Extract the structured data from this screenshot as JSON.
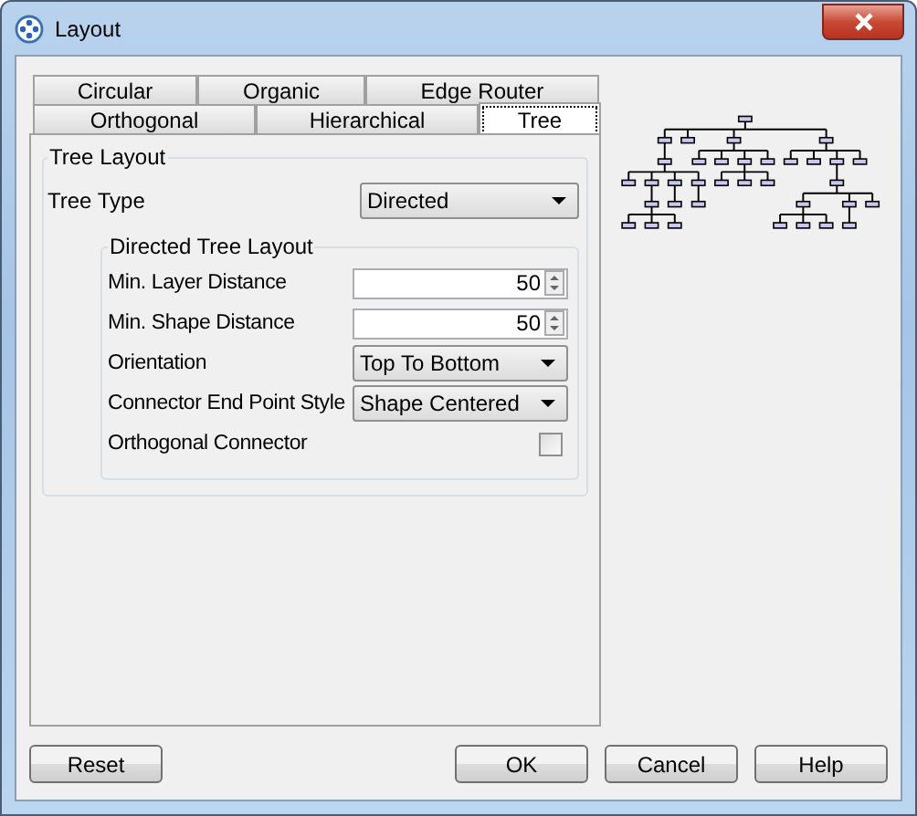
{
  "window": {
    "title": "Layout"
  },
  "tab_rows": [
    [
      {
        "label": "Circular",
        "selected": false
      },
      {
        "label": "Organic",
        "selected": false
      },
      {
        "label": "Edge Router",
        "selected": false
      }
    ],
    [
      {
        "label": "Orthogonal",
        "selected": false
      },
      {
        "label": "Hierarchical",
        "selected": false
      },
      {
        "label": "Tree",
        "selected": true
      }
    ]
  ],
  "tree_layout": {
    "title": "Tree Layout",
    "tree_type": {
      "label": "Tree Type",
      "value": "Directed"
    },
    "directed": {
      "title": "Directed Tree Layout",
      "fields": [
        {
          "kind": "spinner",
          "label": "Min. Layer Distance",
          "value": "50"
        },
        {
          "kind": "spinner",
          "label": "Min. Shape Distance",
          "value": "50"
        },
        {
          "kind": "combo",
          "label": "Orientation",
          "value": "Top To Bottom"
        },
        {
          "kind": "combo",
          "label": "Connector End Point Style",
          "value": "Shape Centered"
        },
        {
          "kind": "checkbox",
          "label": "Orthogonal Connector",
          "checked": false
        }
      ]
    }
  },
  "buttons": {
    "left": [
      "Reset"
    ],
    "right": [
      "OK",
      "Cancel",
      "Help"
    ]
  }
}
